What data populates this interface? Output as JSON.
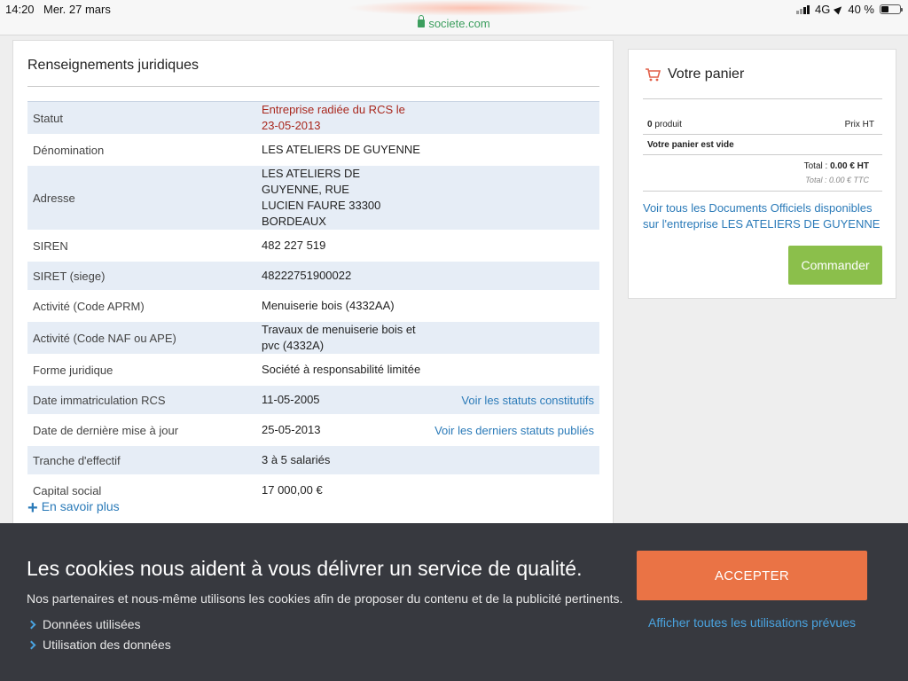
{
  "statusbar": {
    "time": "14:20",
    "date": "Mer. 27 mars",
    "url": "societe.com",
    "network": "4G",
    "battery": "40 %",
    "battery_level": 0.4,
    "url_color": "#3c9e5e"
  },
  "card": {
    "title": "Renseignements juridiques",
    "rows": [
      {
        "label": "Statut",
        "value": "Entreprise radiée du RCS le 23-05-2013",
        "link": ""
      },
      {
        "label": "Dénomination",
        "value": "LES ATELIERS DE GUYENNE",
        "link": ""
      },
      {
        "label": "Adresse",
        "value": "LES ATELIERS DE GUYENNE, RUE LUCIEN FAURE 33300 BORDEAUX",
        "link": ""
      },
      {
        "label": "SIREN",
        "value": "482 227 519",
        "link": ""
      },
      {
        "label": "SIRET (siege)",
        "value": "48222751900022",
        "link": ""
      },
      {
        "label": "Activité (Code APRM)",
        "value": "Menuiserie bois (4332AA)",
        "link": ""
      },
      {
        "label": "Activité (Code NAF ou APE)",
        "value": "Travaux de menuiserie bois et pvc (4332A)",
        "link": ""
      },
      {
        "label": "Forme juridique",
        "value": "Société à responsabilité limitée",
        "link": ""
      },
      {
        "label": "Date immatriculation RCS",
        "value": "11-05-2005",
        "link": "Voir les statuts constitutifs"
      },
      {
        "label": "Date de dernière mise à jour",
        "value": "25-05-2013",
        "link": "Voir les derniers statuts publiés"
      },
      {
        "label": "Tranche d'effectif",
        "value": "3 à 5 salariés",
        "link": ""
      },
      {
        "label": "Capital social",
        "value": "17 000,00 €",
        "link": ""
      }
    ],
    "more_link": "En savoir plus",
    "status_color": "#a9281e",
    "link_color": "#2a7ab8"
  },
  "cart": {
    "title": "Votre panier",
    "count_label": "0",
    "count_suffix": "produit",
    "price_header": "Prix HT",
    "empty": "Votre panier est vide",
    "total_ht_label": "Total :",
    "total_ht_value": "0.00 € HT",
    "total_ttc_label": "Total :",
    "total_ttc_value": "0.00 € TTC",
    "docs_link": "Voir tous les Documents Officiels disponibles sur l'entreprise LES ATELIERS DE GUYENNE",
    "order_button": "Commander",
    "button_color": "#8bbf4b"
  },
  "cookie": {
    "title": "Les cookies nous aident à vous délivrer un service de qualité.",
    "subtitle": "Nos partenaires et nous-même utilisons les cookies afin de proposer du contenu et de la publicité pertinents.",
    "items": [
      "Données utilisées",
      "Utilisation des données"
    ],
    "accept": "ACCEPTER",
    "more": "Afficher toutes les utilisations prévues",
    "accept_color": "#ea7345"
  }
}
